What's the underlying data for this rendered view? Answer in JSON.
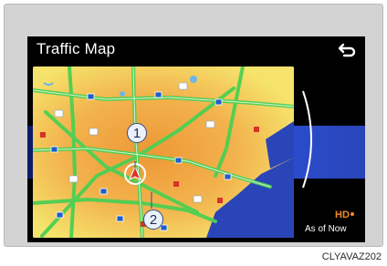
{
  "screen": {
    "title": "Traffic Map",
    "status_text": "As of Now",
    "back_icon": "return-arrow-icon",
    "hd_icon": "hd-radio-icon"
  },
  "map": {
    "callouts": [
      "1",
      "2"
    ],
    "colors": {
      "water": "#2a45b8",
      "land_base": "#f5e36b",
      "urban": "#f0a23c",
      "road_free_flow": "#4ccf53"
    }
  },
  "figure_code": "CLYAVAZ202"
}
